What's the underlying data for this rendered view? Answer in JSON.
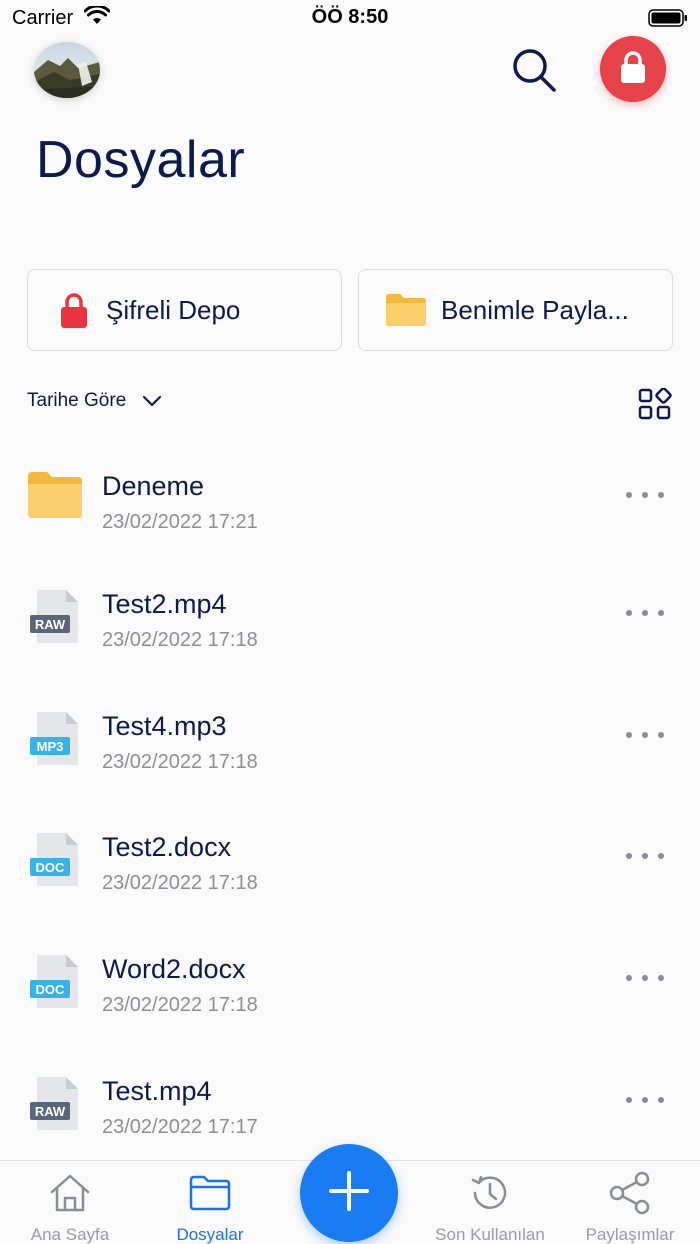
{
  "status_bar": {
    "carrier": "Carrier",
    "time": "ÖÖ 8:50"
  },
  "header": {
    "title": "Dosyalar",
    "avatar": "profile-photo-landscape"
  },
  "quick_access": [
    {
      "label": "Şifreli Depo",
      "icon": "lock-icon",
      "color": "#e8353d"
    },
    {
      "label": "Benimle Payla...",
      "icon": "folder-icon",
      "color": "#f7c45a"
    }
  ],
  "sort": {
    "label": "Tarihe Göre"
  },
  "files": [
    {
      "name": "Deneme",
      "date": "23/02/2022 17:21",
      "type": "folder"
    },
    {
      "name": "Test2.mp4",
      "date": "23/02/2022 17:18",
      "type": "RAW",
      "badge_color": "#5a6778"
    },
    {
      "name": "Test4.mp3",
      "date": "23/02/2022 17:18",
      "type": "MP3",
      "badge_color": "#38b3e6"
    },
    {
      "name": "Test2.docx",
      "date": "23/02/2022 17:18",
      "type": "DOC",
      "badge_color": "#38b3e6"
    },
    {
      "name": "Word2.docx",
      "date": "23/02/2022 17:18",
      "type": "DOC",
      "badge_color": "#38b3e6"
    },
    {
      "name": "Test.mp4",
      "date": "23/02/2022 17:17",
      "type": "RAW",
      "badge_color": "#5a6778"
    }
  ],
  "tabs": [
    {
      "label": "Ana Sayfa",
      "icon": "home-icon"
    },
    {
      "label": "Dosyalar",
      "icon": "folder-icon",
      "active": true
    },
    {
      "label": "Son Kullanılan",
      "icon": "history-icon"
    },
    {
      "label": "Paylaşımlar",
      "icon": "share-icon"
    }
  ],
  "colors": {
    "primary": "#1a7cf2",
    "danger": "#e5424a",
    "text": "#0d1b4a",
    "muted": "#8e8f94"
  }
}
